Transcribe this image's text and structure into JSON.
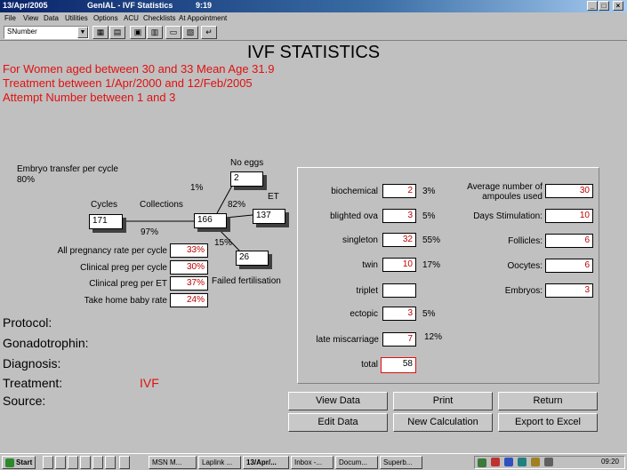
{
  "window": {
    "date": "13/Apr/2005",
    "app": "GenIAL - IVF Statistics",
    "time": "9:19",
    "controls": [
      "_",
      "□",
      "×"
    ]
  },
  "menu": [
    "File",
    "View",
    "Data",
    "Utilities",
    "Options",
    "ACU",
    "Checklists",
    "At Appointment"
  ],
  "toolbar": {
    "combo_value": "SNumber"
  },
  "report": {
    "heading": "IVF STATISTICS",
    "line1": "For Women aged between 30 and 33 Mean Age 31.9",
    "line2": "Treatment between  1/Apr/2000 and 12/Feb/2005",
    "line3": "Attempt Number between 1 and  3"
  },
  "flow": {
    "embryo_transfer_label": "Embryo transfer per cycle",
    "embryo_transfer_pct": "80%",
    "no_eggs_label": "No eggs",
    "no_eggs_value": "2",
    "no_eggs_pct": "1%",
    "cycles_label": "Cycles",
    "cycles_value": "171",
    "collections_label": "Collections",
    "collections_pct": "97%",
    "collections_value": "166",
    "et_label": "ET",
    "et_pct": "82%",
    "et_value": "137",
    "failed_pct": "15%",
    "failed_value": "26",
    "failed_label": "Failed fertilisation"
  },
  "rates": [
    {
      "label": "All pregnancy rate per cycle",
      "value": "33%"
    },
    {
      "label": "Clinical preg per cycle",
      "value": "30%"
    },
    {
      "label": "Clinical preg per ET",
      "value": "37%"
    },
    {
      "label": "Take home baby rate",
      "value": "24%"
    }
  ],
  "outcomes": [
    {
      "label": "biochemical",
      "value": "2",
      "pct": "3%"
    },
    {
      "label": "blighted ova",
      "value": "3",
      "pct": "5%"
    },
    {
      "label": "singleton",
      "value": "32",
      "pct": "55%"
    },
    {
      "label": "twin",
      "value": "10",
      "pct": "17%"
    },
    {
      "label": "triplet",
      "value": "",
      "pct": ""
    },
    {
      "label": "ectopic",
      "value": "3",
      "pct": "5%"
    },
    {
      "label": "late miscarriage",
      "value": "7",
      "pct": "12%"
    },
    {
      "label": "total",
      "value": "58",
      "pct": ""
    }
  ],
  "averages": {
    "ampoules_label_1": "Average number of",
    "ampoules_label_2": "ampoules used",
    "ampoules_value": "30",
    "items": [
      {
        "label": "Days Stimulation:",
        "value": "10"
      },
      {
        "label": "Follicles:",
        "value": "6"
      },
      {
        "label": "Oocytes:",
        "value": "6"
      },
      {
        "label": "Embryos:",
        "value": "3"
      }
    ]
  },
  "details": {
    "protocol": "Protocol:",
    "gonadotrophin": "Gonadotrophin:",
    "diagnosis": "Diagnosis:",
    "treatment": "Treatment:",
    "treatment_value": "IVF",
    "source": "Source:"
  },
  "buttons": {
    "view_data": "View Data",
    "print": "Print",
    "return": "Return",
    "edit_data": "Edit Data",
    "new_calculation": "New Calculation",
    "export": "Export to Excel"
  },
  "taskbar": {
    "start": "Start",
    "tasks": [
      "MSN M...",
      "Laplink ...",
      "13/Apr/...",
      "Inbox -...",
      "Docum...",
      "Superb..."
    ],
    "clock": "09:20"
  },
  "colors": {
    "accent_red": "#e01010",
    "value_red": "#c00000",
    "titlebar": "#0a246a"
  }
}
